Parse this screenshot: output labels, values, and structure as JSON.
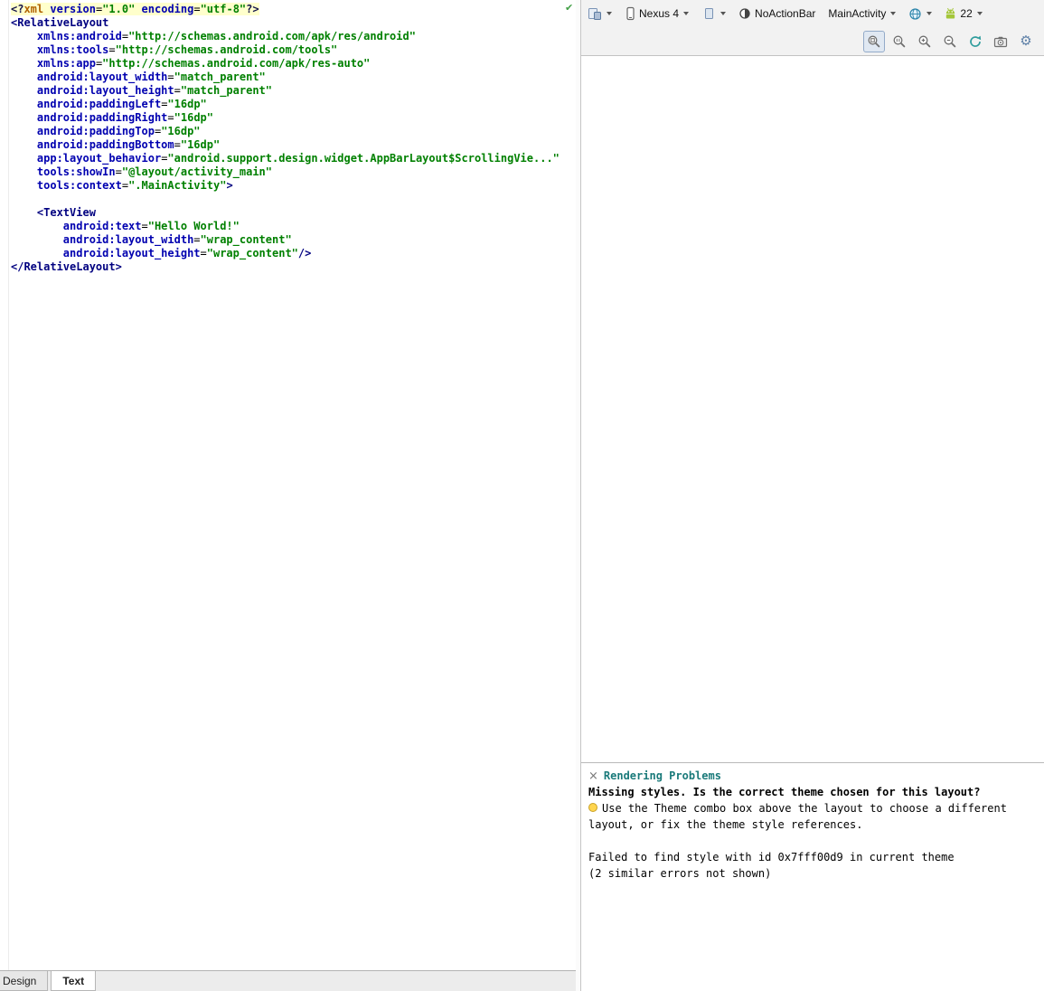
{
  "colors": {
    "tag": "#000080",
    "attr": "#0000b0",
    "value": "#008000",
    "pi": "#b06100",
    "line_highlight": "#ffffcc",
    "problems_title": "#1a7a7a",
    "toolbar_bg": "#f2f2f2"
  },
  "icons": {
    "inspection_check": "✔",
    "close": "×",
    "gear": "⚙"
  },
  "editor": {
    "lines": [
      {
        "h": true,
        "s": [
          [
            "punct",
            "<?"
          ],
          [
            "pi",
            "xml"
          ],
          [
            "plain",
            " "
          ],
          [
            "attr",
            "version"
          ],
          [
            "eq",
            "="
          ],
          [
            "val",
            "\"1.0\""
          ],
          [
            "plain",
            " "
          ],
          [
            "attr",
            "encoding"
          ],
          [
            "eq",
            "="
          ],
          [
            "val",
            "\"utf-8\""
          ],
          [
            "punct",
            "?>"
          ]
        ]
      },
      {
        "s": [
          [
            "tag",
            "<RelativeLayout"
          ]
        ]
      },
      {
        "s": [
          [
            "plain",
            "    "
          ],
          [
            "attr",
            "xmlns:android"
          ],
          [
            "eq",
            "="
          ],
          [
            "val",
            "\"http://schemas.android.com/apk/res/android\""
          ]
        ]
      },
      {
        "s": [
          [
            "plain",
            "    "
          ],
          [
            "attr",
            "xmlns:tools"
          ],
          [
            "eq",
            "="
          ],
          [
            "val",
            "\"http://schemas.android.com/tools\""
          ]
        ]
      },
      {
        "s": [
          [
            "plain",
            "    "
          ],
          [
            "attr",
            "xmlns:app"
          ],
          [
            "eq",
            "="
          ],
          [
            "val",
            "\"http://schemas.android.com/apk/res-auto\""
          ]
        ]
      },
      {
        "s": [
          [
            "plain",
            "    "
          ],
          [
            "attr",
            "android:layout_width"
          ],
          [
            "eq",
            "="
          ],
          [
            "val",
            "\"match_parent\""
          ]
        ]
      },
      {
        "s": [
          [
            "plain",
            "    "
          ],
          [
            "attr",
            "android:layout_height"
          ],
          [
            "eq",
            "="
          ],
          [
            "val",
            "\"match_parent\""
          ]
        ]
      },
      {
        "s": [
          [
            "plain",
            "    "
          ],
          [
            "attr",
            "android:paddingLeft"
          ],
          [
            "eq",
            "="
          ],
          [
            "val",
            "\"16dp\""
          ]
        ]
      },
      {
        "s": [
          [
            "plain",
            "    "
          ],
          [
            "attr",
            "android:paddingRight"
          ],
          [
            "eq",
            "="
          ],
          [
            "val",
            "\"16dp\""
          ]
        ]
      },
      {
        "s": [
          [
            "plain",
            "    "
          ],
          [
            "attr",
            "android:paddingTop"
          ],
          [
            "eq",
            "="
          ],
          [
            "val",
            "\"16dp\""
          ]
        ]
      },
      {
        "s": [
          [
            "plain",
            "    "
          ],
          [
            "attr",
            "android:paddingBottom"
          ],
          [
            "eq",
            "="
          ],
          [
            "val",
            "\"16dp\""
          ]
        ]
      },
      {
        "s": [
          [
            "plain",
            "    "
          ],
          [
            "attr",
            "app:layout_behavior"
          ],
          [
            "eq",
            "="
          ],
          [
            "val",
            "\"android.support.design.widget.AppBarLayout$ScrollingVie...\""
          ]
        ]
      },
      {
        "s": [
          [
            "plain",
            "    "
          ],
          [
            "attr",
            "tools:showIn"
          ],
          [
            "eq",
            "="
          ],
          [
            "val",
            "\"@layout/activity_main\""
          ]
        ]
      },
      {
        "s": [
          [
            "plain",
            "    "
          ],
          [
            "attr",
            "tools:context"
          ],
          [
            "eq",
            "="
          ],
          [
            "val",
            "\".MainActivity\""
          ],
          [
            "tag",
            ">"
          ]
        ]
      },
      {
        "s": []
      },
      {
        "s": [
          [
            "plain",
            "    "
          ],
          [
            "tag",
            "<TextView"
          ]
        ]
      },
      {
        "s": [
          [
            "plain",
            "        "
          ],
          [
            "attr",
            "android:text"
          ],
          [
            "eq",
            "="
          ],
          [
            "val",
            "\"Hello World!\""
          ]
        ]
      },
      {
        "s": [
          [
            "plain",
            "        "
          ],
          [
            "attr",
            "android:layout_width"
          ],
          [
            "eq",
            "="
          ],
          [
            "val",
            "\"wrap_content\""
          ]
        ]
      },
      {
        "s": [
          [
            "plain",
            "        "
          ],
          [
            "attr",
            "android:layout_height"
          ],
          [
            "eq",
            "="
          ],
          [
            "val",
            "\"wrap_content\""
          ],
          [
            "tag",
            "/>"
          ]
        ]
      },
      {
        "s": [
          [
            "tag",
            "</RelativeLayout>"
          ]
        ]
      }
    ]
  },
  "preview_toolbar": {
    "device_label": "Nexus 4",
    "theme_label": "NoActionBar",
    "activity_label": "MainActivity",
    "api_label": "22"
  },
  "problems": {
    "title": "Rendering Problems",
    "message_bold": "Missing styles. Is the correct theme chosen for this layout?",
    "hint": "Use the Theme combo box above the layout to choose a different layout, or fix the theme style references.",
    "error_detail": "Failed to find style with id 0x7fff00d9 in current theme",
    "error_more": "(2 similar errors not shown)"
  },
  "footer_tabs": {
    "design": "Design",
    "text": "Text"
  }
}
